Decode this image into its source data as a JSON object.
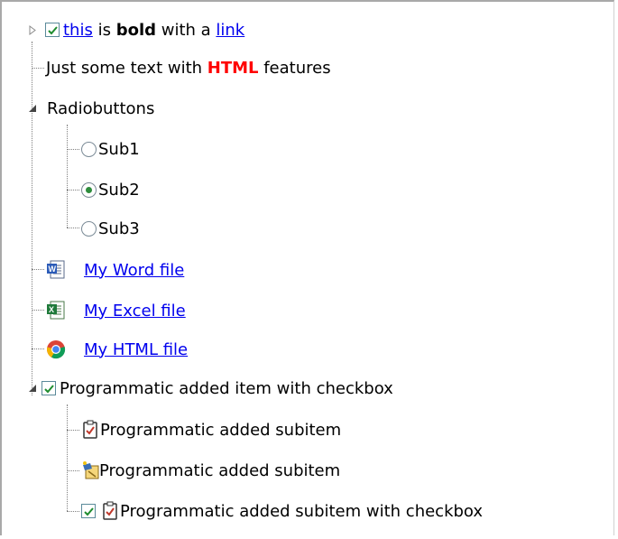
{
  "tree": {
    "row1": {
      "part_link1": "this",
      "part_text1": " is ",
      "part_bold": "bold",
      "part_text2": " with a ",
      "part_link2": "link"
    },
    "row2": {
      "pre": "Just some text with ",
      "html": "HTML",
      "post": " features"
    },
    "radio_group": {
      "label": "Radiobuttons",
      "options": [
        "Sub1",
        "Sub2",
        "Sub3"
      ],
      "selected": "Sub2"
    },
    "files": {
      "word": "My Word file",
      "excel": "My Excel file",
      "html": "My HTML file"
    },
    "programmatic": {
      "label": "Programmatic added item with checkbox",
      "sub1": "Programmatic added subitem",
      "sub2": "Programmatic added subitem",
      "sub3": "Programmatic added subitem with checkbox"
    }
  },
  "colors": {
    "link": "#0000ee",
    "html_highlight": "#ff0000",
    "check": "#1e8c2e"
  },
  "icons": [
    "expand-triangle-icon",
    "collapse-triangle-icon",
    "checkbox-checked-icon",
    "radio-icon",
    "word-file-icon",
    "excel-file-icon",
    "chrome-icon",
    "clipboard-check-icon",
    "wizard-icon"
  ]
}
